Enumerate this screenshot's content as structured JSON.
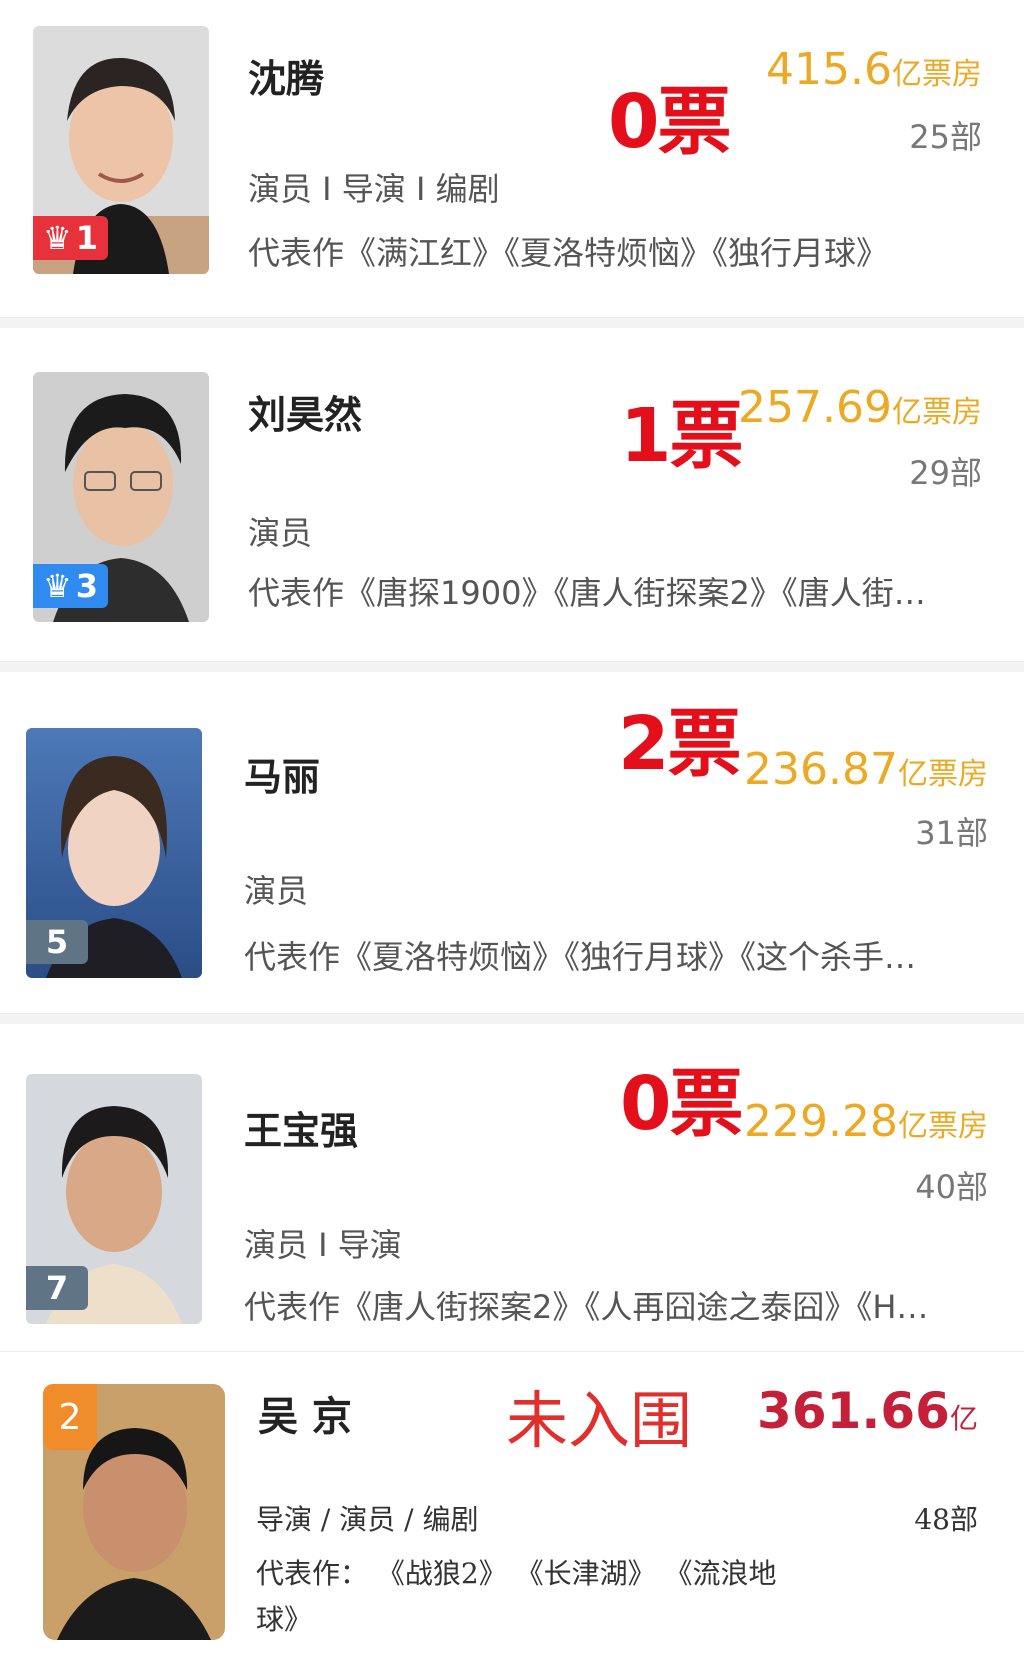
{
  "cards": [
    {
      "name": "沈腾",
      "roles": "演员 I 导演 I 编剧",
      "works": "代表作《满江红》《夏洛特烦恼》《独行月球》",
      "votes": "0票",
      "box_value": "415.6",
      "box_unit": "亿票房",
      "film_count": "25部",
      "rank": "1",
      "rank_icon": "crown-icon",
      "rank_color": "#e8323b"
    },
    {
      "name": "刘昊然",
      "roles": "演员",
      "works": "代表作《唐探1900》《唐人街探案2》《唐人街…",
      "votes": "1票",
      "box_value": "257.69",
      "box_unit": "亿票房",
      "film_count": "29部",
      "rank": "3",
      "rank_icon": "crown-icon",
      "rank_color": "#2f8bef"
    },
    {
      "name": "马丽",
      "roles": "演员",
      "works": "代表作《夏洛特烦恼》《独行月球》《这个杀手…",
      "votes": "2票",
      "box_value": "236.87",
      "box_unit": "亿票房",
      "film_count": "31部",
      "rank": "5",
      "rank_color": "#5f7585"
    },
    {
      "name": "王宝强",
      "roles": "演员 I 导演",
      "works": "代表作《唐人街探案2》《人再囧途之泰囧》《H…",
      "votes": "0票",
      "box_value": "229.28",
      "box_unit": "亿票房",
      "film_count": "40部",
      "rank": "7",
      "rank_color": "#5f7585"
    }
  ],
  "last_card": {
    "name": "吴 京",
    "roles": "导演 / 演员 / 编剧",
    "works_line1": "代表作：  《战狼2》  《长津湖》  《流浪地",
    "works_line2": "球》",
    "status": "未入围",
    "box_value": "361.66",
    "box_unit": "亿",
    "film_count": "48部",
    "rank": "2",
    "rank_color": "#f08c2a"
  },
  "colors": {
    "vote_red": "#e3101b",
    "box_gold": "#eba924",
    "last_box_red": "#c4203a",
    "status_red": "#e0302d"
  }
}
